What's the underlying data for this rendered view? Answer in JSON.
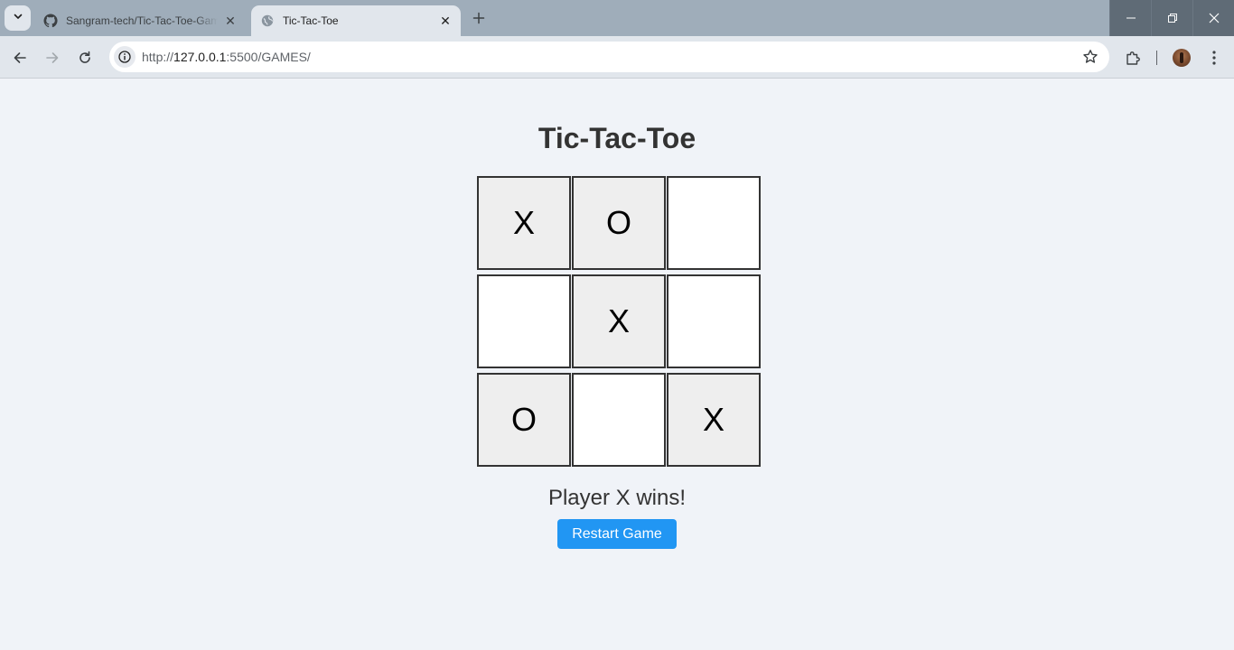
{
  "browser": {
    "tabs": [
      {
        "title": "Sangram-tech/Tic-Tac-Toe-Game",
        "favicon": "github-icon",
        "active": false
      },
      {
        "title": "Tic-Tac-Toe",
        "favicon": "globe-icon",
        "active": true
      }
    ],
    "address": {
      "scheme": "http://",
      "host": "127.0.0.1",
      "rest": ":5500/GAMES/"
    }
  },
  "game": {
    "title": "Tic-Tac-Toe",
    "board": [
      "X",
      "O",
      "",
      "",
      "X",
      "",
      "O",
      "",
      "X"
    ],
    "status": "Player X wins!",
    "restart_label": "Restart Game"
  },
  "colors": {
    "accent": "#2196f3",
    "page_background": "#f0f3f8",
    "filled_cell": "#eeeeee",
    "empty_cell": "#ffffff"
  }
}
